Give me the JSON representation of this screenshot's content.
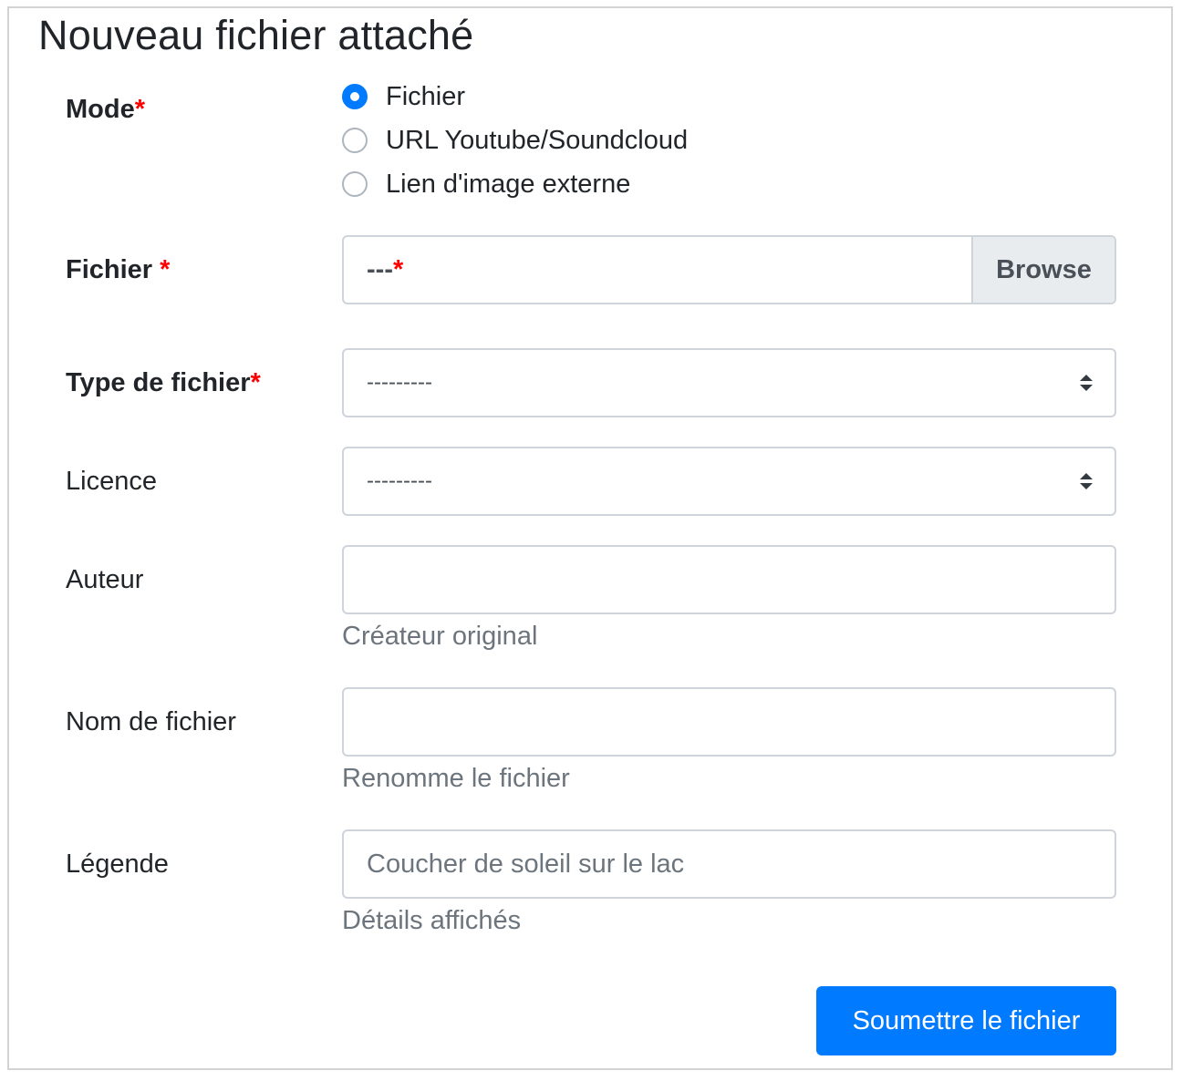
{
  "form": {
    "title": "Nouveau fichier attaché",
    "required_marker": "*",
    "mode": {
      "label": "Mode",
      "options": [
        {
          "label": "Fichier",
          "checked": true
        },
        {
          "label": "URL Youtube/Soundcloud",
          "checked": false
        },
        {
          "label": "Lien d'image externe",
          "checked": false
        }
      ]
    },
    "file": {
      "label": "Fichier ",
      "value": "---",
      "browse_label": "Browse"
    },
    "file_type": {
      "label": "Type de fichier",
      "selected": "---------"
    },
    "license": {
      "label": "Licence",
      "selected": "---------"
    },
    "author": {
      "label": "Auteur",
      "value": "",
      "help": "Créateur original"
    },
    "filename": {
      "label": "Nom de fichier",
      "value": "",
      "help": "Renomme le fichier"
    },
    "caption": {
      "label": "Légende",
      "placeholder": "Coucher de soleil sur le lac",
      "help": "Détails affichés"
    },
    "submit_label": "Soumettre le fichier",
    "colors": {
      "primary": "#007bff",
      "required": "#ff0000",
      "muted": "#6c757d",
      "border": "#ced4da"
    },
    "icons": {
      "select_arrow": "select-arrows-icon"
    }
  }
}
